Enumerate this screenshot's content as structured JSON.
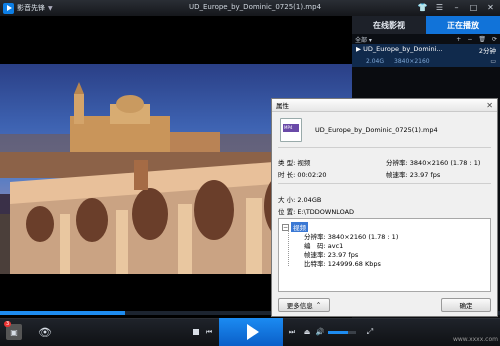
{
  "app": {
    "name": "影音先锋",
    "window_title": "UD_Europe_by_Dominic_0725(1).mp4"
  },
  "panel": {
    "tabs": [
      "在线影视",
      "正在播放"
    ],
    "list_filter": "全部",
    "item": {
      "name": "UD_Europe_by_Domini...",
      "duration": "2分钟",
      "size": "2.04G",
      "resolution": "3840×2160"
    }
  },
  "dialog": {
    "title": "属性",
    "filename": "UD_Europe_by_Dominic_0725(1).mp4",
    "type_label": "类 型:",
    "type_value": "视频",
    "duration_label": "时 长:",
    "duration_value": "00:02:20",
    "resolution_label": "分辨率:",
    "resolution_value": "3840×2160 (1.78 : 1)",
    "framerate_label": "帧速率:",
    "framerate_value": "23.97 fps",
    "size_label": "大 小:",
    "size_value": "2.04GB",
    "location_label": "位 置:",
    "location_value": "E:\\TDDOWNLOAD",
    "detail_header": "视频",
    "details": [
      "分辨率: 3840×2160 (1.78 : 1)",
      "编　码: avc1",
      "帧速率: 23.97 fps",
      "比特率: 124999.68 Kbps"
    ],
    "more_button": "更多信息",
    "ok_button": "确定"
  },
  "controls": {
    "notification_count": "3",
    "watermark": "www.xxxx.com"
  },
  "progress": 0.25,
  "colors": {
    "accent": "#1173d9",
    "panel_bg": "#0a0c10",
    "dialog_bg": "#f0f0f0"
  }
}
